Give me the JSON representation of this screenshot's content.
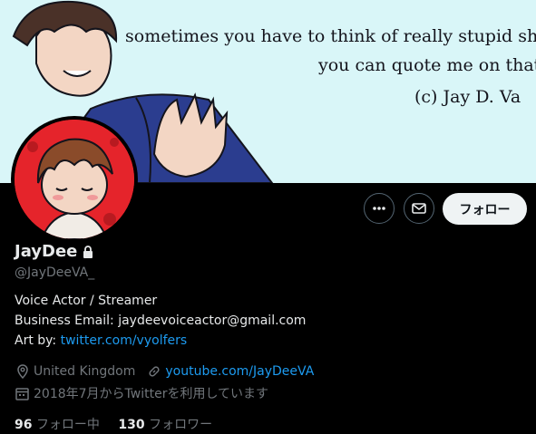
{
  "banner": {
    "line1": "sometimes you have to think of really stupid shit to be smart",
    "line2": "you can quote me on that",
    "signature": "(c) Jay D. Va"
  },
  "actions": {
    "follow_label": "フォロー"
  },
  "profile": {
    "name": "JayDee",
    "handle": "@JayDeeVA_",
    "bio_line1": "Voice Actor / Streamer",
    "bio_line2": "Business Email: jaydeevoiceactor@gmail.com",
    "bio_art_prefix": "Art by: ",
    "bio_art_link": "twitter.com/vyolfers",
    "location": "United Kingdom",
    "website": "youtube.com/JayDeeVA",
    "joined": "2018年7月からTwitterを利用しています",
    "following_count": "96",
    "following_label": "フォロー中",
    "followers_count": "130",
    "followers_label": "フォロワー"
  },
  "colors": {
    "link": "#1d9bf0",
    "banner_bg": "#d9f6f8",
    "avatar_bg": "#e5242b"
  }
}
